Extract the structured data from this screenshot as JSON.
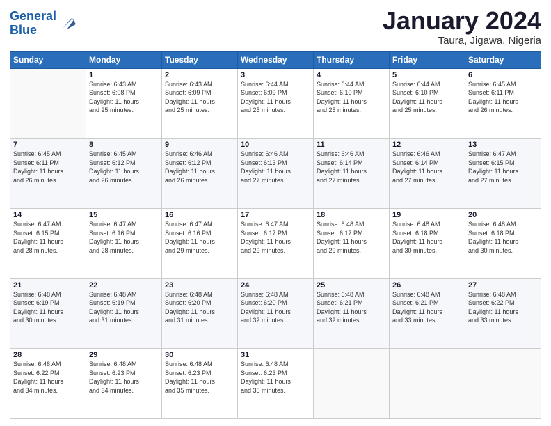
{
  "logo": {
    "line1": "General",
    "line2": "Blue"
  },
  "title": "January 2024",
  "subtitle": "Taura, Jigawa, Nigeria",
  "days_header": [
    "Sunday",
    "Monday",
    "Tuesday",
    "Wednesday",
    "Thursday",
    "Friday",
    "Saturday"
  ],
  "weeks": [
    [
      {
        "day": "",
        "info": ""
      },
      {
        "day": "1",
        "info": "Sunrise: 6:43 AM\nSunset: 6:08 PM\nDaylight: 11 hours\nand 25 minutes."
      },
      {
        "day": "2",
        "info": "Sunrise: 6:43 AM\nSunset: 6:09 PM\nDaylight: 11 hours\nand 25 minutes."
      },
      {
        "day": "3",
        "info": "Sunrise: 6:44 AM\nSunset: 6:09 PM\nDaylight: 11 hours\nand 25 minutes."
      },
      {
        "day": "4",
        "info": "Sunrise: 6:44 AM\nSunset: 6:10 PM\nDaylight: 11 hours\nand 25 minutes."
      },
      {
        "day": "5",
        "info": "Sunrise: 6:44 AM\nSunset: 6:10 PM\nDaylight: 11 hours\nand 25 minutes."
      },
      {
        "day": "6",
        "info": "Sunrise: 6:45 AM\nSunset: 6:11 PM\nDaylight: 11 hours\nand 26 minutes."
      }
    ],
    [
      {
        "day": "7",
        "info": "Sunrise: 6:45 AM\nSunset: 6:11 PM\nDaylight: 11 hours\nand 26 minutes."
      },
      {
        "day": "8",
        "info": "Sunrise: 6:45 AM\nSunset: 6:12 PM\nDaylight: 11 hours\nand 26 minutes."
      },
      {
        "day": "9",
        "info": "Sunrise: 6:46 AM\nSunset: 6:12 PM\nDaylight: 11 hours\nand 26 minutes."
      },
      {
        "day": "10",
        "info": "Sunrise: 6:46 AM\nSunset: 6:13 PM\nDaylight: 11 hours\nand 27 minutes."
      },
      {
        "day": "11",
        "info": "Sunrise: 6:46 AM\nSunset: 6:14 PM\nDaylight: 11 hours\nand 27 minutes."
      },
      {
        "day": "12",
        "info": "Sunrise: 6:46 AM\nSunset: 6:14 PM\nDaylight: 11 hours\nand 27 minutes."
      },
      {
        "day": "13",
        "info": "Sunrise: 6:47 AM\nSunset: 6:15 PM\nDaylight: 11 hours\nand 27 minutes."
      }
    ],
    [
      {
        "day": "14",
        "info": "Sunrise: 6:47 AM\nSunset: 6:15 PM\nDaylight: 11 hours\nand 28 minutes."
      },
      {
        "day": "15",
        "info": "Sunrise: 6:47 AM\nSunset: 6:16 PM\nDaylight: 11 hours\nand 28 minutes."
      },
      {
        "day": "16",
        "info": "Sunrise: 6:47 AM\nSunset: 6:16 PM\nDaylight: 11 hours\nand 29 minutes."
      },
      {
        "day": "17",
        "info": "Sunrise: 6:47 AM\nSunset: 6:17 PM\nDaylight: 11 hours\nand 29 minutes."
      },
      {
        "day": "18",
        "info": "Sunrise: 6:48 AM\nSunset: 6:17 PM\nDaylight: 11 hours\nand 29 minutes."
      },
      {
        "day": "19",
        "info": "Sunrise: 6:48 AM\nSunset: 6:18 PM\nDaylight: 11 hours\nand 30 minutes."
      },
      {
        "day": "20",
        "info": "Sunrise: 6:48 AM\nSunset: 6:18 PM\nDaylight: 11 hours\nand 30 minutes."
      }
    ],
    [
      {
        "day": "21",
        "info": "Sunrise: 6:48 AM\nSunset: 6:19 PM\nDaylight: 11 hours\nand 30 minutes."
      },
      {
        "day": "22",
        "info": "Sunrise: 6:48 AM\nSunset: 6:19 PM\nDaylight: 11 hours\nand 31 minutes."
      },
      {
        "day": "23",
        "info": "Sunrise: 6:48 AM\nSunset: 6:20 PM\nDaylight: 11 hours\nand 31 minutes."
      },
      {
        "day": "24",
        "info": "Sunrise: 6:48 AM\nSunset: 6:20 PM\nDaylight: 11 hours\nand 32 minutes."
      },
      {
        "day": "25",
        "info": "Sunrise: 6:48 AM\nSunset: 6:21 PM\nDaylight: 11 hours\nand 32 minutes."
      },
      {
        "day": "26",
        "info": "Sunrise: 6:48 AM\nSunset: 6:21 PM\nDaylight: 11 hours\nand 33 minutes."
      },
      {
        "day": "27",
        "info": "Sunrise: 6:48 AM\nSunset: 6:22 PM\nDaylight: 11 hours\nand 33 minutes."
      }
    ],
    [
      {
        "day": "28",
        "info": "Sunrise: 6:48 AM\nSunset: 6:22 PM\nDaylight: 11 hours\nand 34 minutes."
      },
      {
        "day": "29",
        "info": "Sunrise: 6:48 AM\nSunset: 6:23 PM\nDaylight: 11 hours\nand 34 minutes."
      },
      {
        "day": "30",
        "info": "Sunrise: 6:48 AM\nSunset: 6:23 PM\nDaylight: 11 hours\nand 35 minutes."
      },
      {
        "day": "31",
        "info": "Sunrise: 6:48 AM\nSunset: 6:23 PM\nDaylight: 11 hours\nand 35 minutes."
      },
      {
        "day": "",
        "info": ""
      },
      {
        "day": "",
        "info": ""
      },
      {
        "day": "",
        "info": ""
      }
    ]
  ]
}
